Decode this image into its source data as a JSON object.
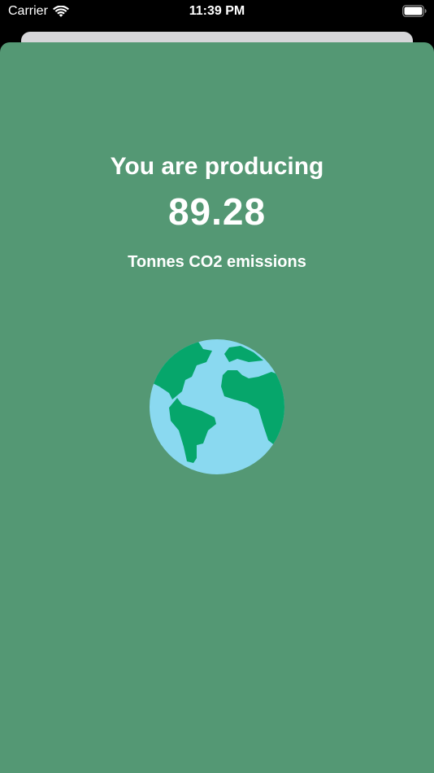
{
  "status_bar": {
    "carrier": "Carrier",
    "time": "11:39 PM",
    "wifi_icon": "wifi-icon",
    "battery_icon": "battery-icon"
  },
  "result": {
    "headline": "You are producing",
    "value": "89.28",
    "unit": "Tonnes CO2 emissions"
  },
  "illustration": {
    "icon": "earth-globe-icon",
    "ocean_color": "#8ad9f0",
    "land_color": "#06a66b"
  },
  "colors": {
    "card_background": "#549874",
    "text": "#ffffff",
    "status_bar_background": "#000000"
  }
}
